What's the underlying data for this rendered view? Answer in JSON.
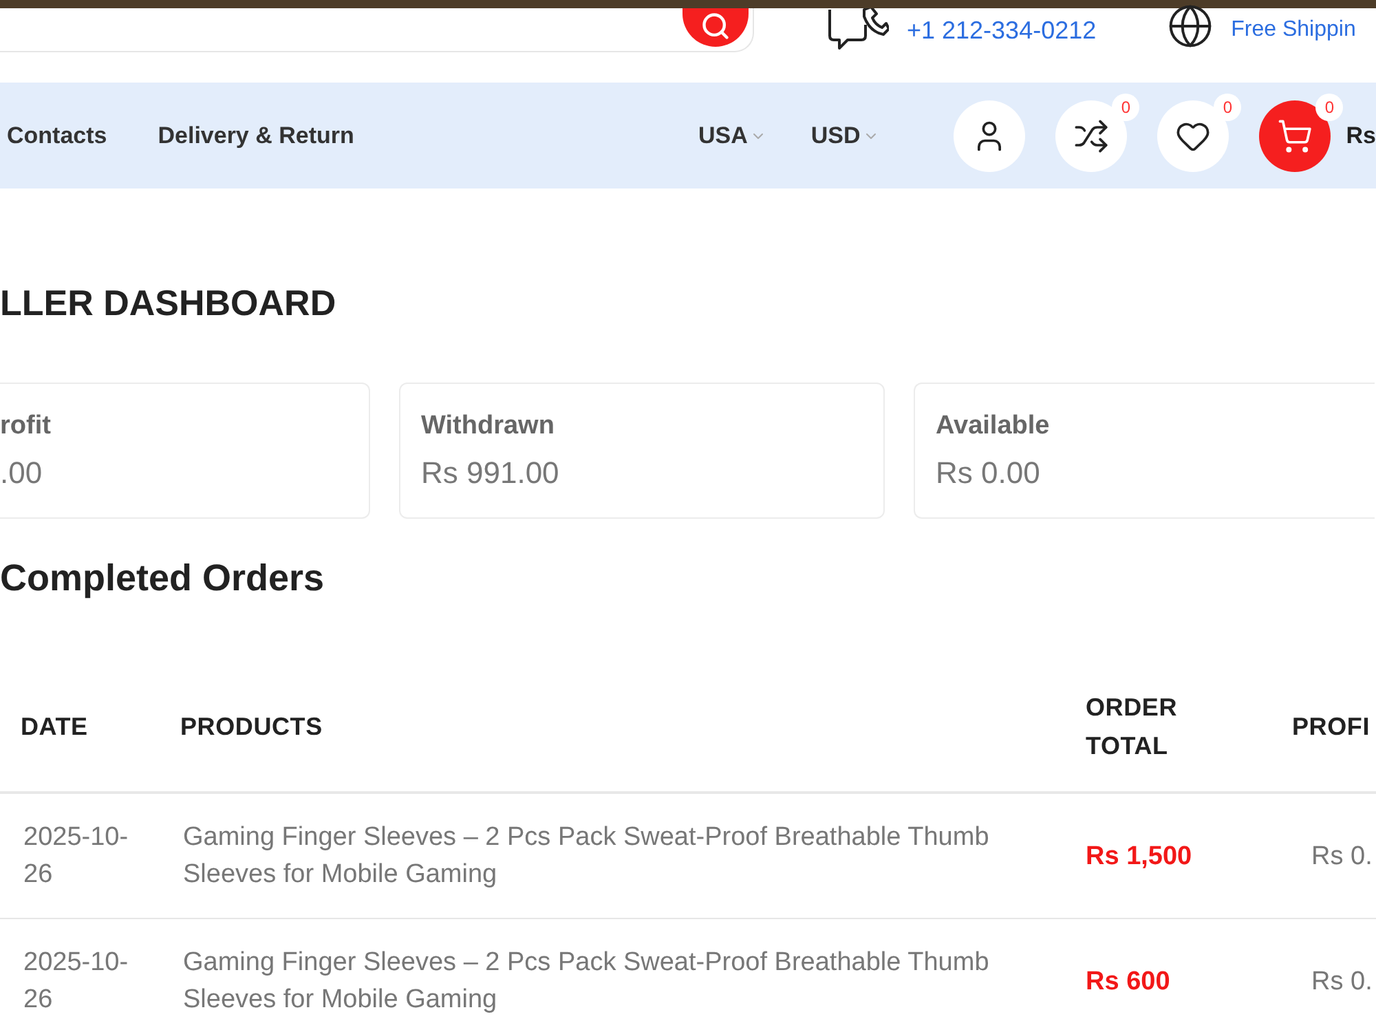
{
  "header": {
    "phone": "+1 212-334-0212",
    "shipping": "Free Shippin"
  },
  "nav": {
    "links": [
      "Contacts",
      "Delivery & Return"
    ],
    "selectors": [
      "USA",
      "USD"
    ],
    "actions": [
      {
        "kind": "account"
      },
      {
        "kind": "compare",
        "badge": "0"
      },
      {
        "kind": "wishlist",
        "badge": "0"
      },
      {
        "kind": "cart",
        "badge": "0"
      }
    ],
    "cart_total": "Rs"
  },
  "page_title": "LLER DASHBOARD",
  "stats": [
    {
      "label": "rofit",
      "value": ".00"
    },
    {
      "label": "Withdrawn",
      "value": "Rs 991.00"
    },
    {
      "label": "Available",
      "value": "Rs 0.00"
    }
  ],
  "orders": {
    "title": "Completed Orders",
    "columns": [
      "DATE",
      "PRODUCTS",
      "ORDER TOTAL",
      "PROFI"
    ],
    "rows": [
      {
        "date": "2025-10-26",
        "product": "Gaming Finger Sleeves – 2 Pcs Pack Sweat-Proof Breathable Thumb Sleeves for Mobile Gaming",
        "order_total": "Rs 1,500",
        "column_4": "Rs 0."
      },
      {
        "date": "2025-10-26",
        "product": "Gaming Finger Sleeves – 2 Pcs Pack Sweat-Proof Breathable Thumb Sleeves for Mobile Gaming",
        "order_total": "Rs 600",
        "column_4": "Rs 0."
      }
    ]
  }
}
